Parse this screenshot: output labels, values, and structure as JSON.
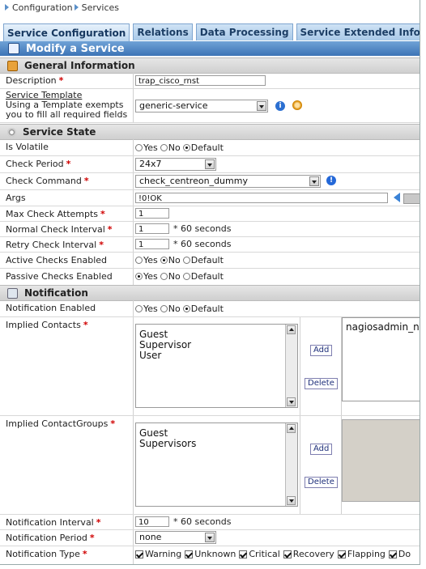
{
  "breadcrumb": {
    "root": "Configuration",
    "current": "Services"
  },
  "tabs": [
    {
      "label": "Service Configuration",
      "active": true
    },
    {
      "label": "Relations"
    },
    {
      "label": "Data Processing"
    },
    {
      "label": "Service Extended Info"
    },
    {
      "label": "M"
    }
  ],
  "band_title": "Modify a Service",
  "sections": {
    "general": "General Information",
    "state": "Service State",
    "notification": "Notification"
  },
  "fields": {
    "description": {
      "label": "Description",
      "value": "trap_cisco_rnst"
    },
    "template": {
      "label": "Service Template",
      "help": "Using a Template exempts you to fill all required fields",
      "help_line1": "Using a Template exempts",
      "help_line2": "you to fill all required fields",
      "value": "generic-service"
    },
    "is_volatile": {
      "label": "Is Volatile",
      "options": [
        "Yes",
        "No",
        "Default"
      ],
      "selected": "Default"
    },
    "check_period": {
      "label": "Check Period",
      "value": "24x7"
    },
    "check_command": {
      "label": "Check Command",
      "value": "check_centreon_dummy"
    },
    "args": {
      "label": "Args",
      "value": "!0!OK"
    },
    "max_check_attempts": {
      "label": "Max Check Attempts",
      "value": "1"
    },
    "normal_check_interval": {
      "label": "Normal Check Interval",
      "value": "1",
      "unit": "* 60 seconds"
    },
    "retry_check_interval": {
      "label": "Retry Check Interval",
      "value": "1",
      "unit": "* 60 seconds"
    },
    "active_checks": {
      "label": "Active Checks Enabled",
      "options": [
        "Yes",
        "No",
        "Default"
      ],
      "selected": "No"
    },
    "passive_checks": {
      "label": "Passive Checks Enabled",
      "options": [
        "Yes",
        "No",
        "Default"
      ],
      "selected": "Yes"
    },
    "notification_enabled": {
      "label": "Notification Enabled",
      "options": [
        "Yes",
        "No",
        "Default"
      ],
      "selected": "Default"
    },
    "implied_contacts": {
      "label": "Implied Contacts",
      "available": [
        "Guest",
        "Supervisor",
        "User"
      ],
      "selected": [
        "nagiosadmin_na"
      ],
      "add_label": "Add",
      "delete_label": "Delete"
    },
    "implied_contactgroups": {
      "label": "Implied ContactGroups",
      "available": [
        "Guest",
        "Supervisors"
      ],
      "selected": [],
      "add_label": "Add",
      "delete_label": "Delete"
    },
    "notification_interval": {
      "label": "Notification Interval",
      "value": "10",
      "unit": "* 60 seconds"
    },
    "notification_period": {
      "label": "Notification Period",
      "value": "none"
    },
    "notification_type": {
      "label": "Notification Type",
      "options": [
        "Warning",
        "Unknown",
        "Critical",
        "Recovery",
        "Flapping",
        "Do"
      ]
    }
  }
}
